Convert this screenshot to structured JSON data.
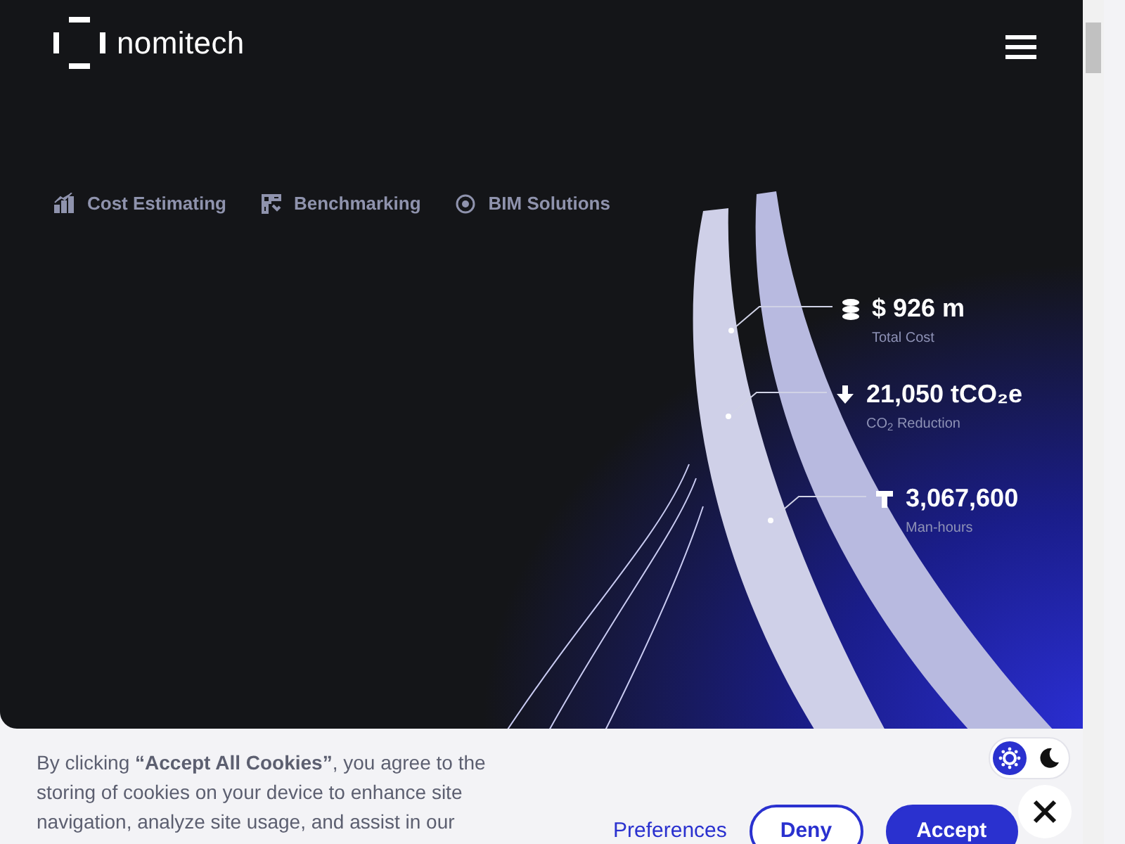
{
  "brand": {
    "name": "nomitech"
  },
  "services": [
    {
      "label": "Cost Estimating",
      "kind": "chart"
    },
    {
      "label": "Benchmarking",
      "kind": "bench"
    },
    {
      "label": "BIM Solutions",
      "kind": "bim"
    }
  ],
  "stats": [
    {
      "value": "$ 926 m",
      "label": "Total Cost",
      "kind": "coins"
    },
    {
      "value": "21,050 tCO₂e",
      "label": "CO$_{2}$ Reduction",
      "kind": "down"
    },
    {
      "value": "3,067,600",
      "label": "Man-hours",
      "kind": "tool"
    }
  ],
  "cookie_banner": {
    "text": "By clicking **“Accept All Cookies”**, you agree to the storing of cookies on your device to enhance site navigation, analyze site usage, and assist in our",
    "buttons": [
      {
        "label": "Preferences",
        "kind": "link"
      },
      {
        "label": "Deny",
        "kind": "outline"
      },
      {
        "label": "Accept",
        "kind": "primary"
      }
    ]
  },
  "theme_toggle": {
    "options": [
      {
        "kind": "light",
        "selected": true
      },
      {
        "kind": "dark",
        "selected": false
      }
    ]
  }
}
